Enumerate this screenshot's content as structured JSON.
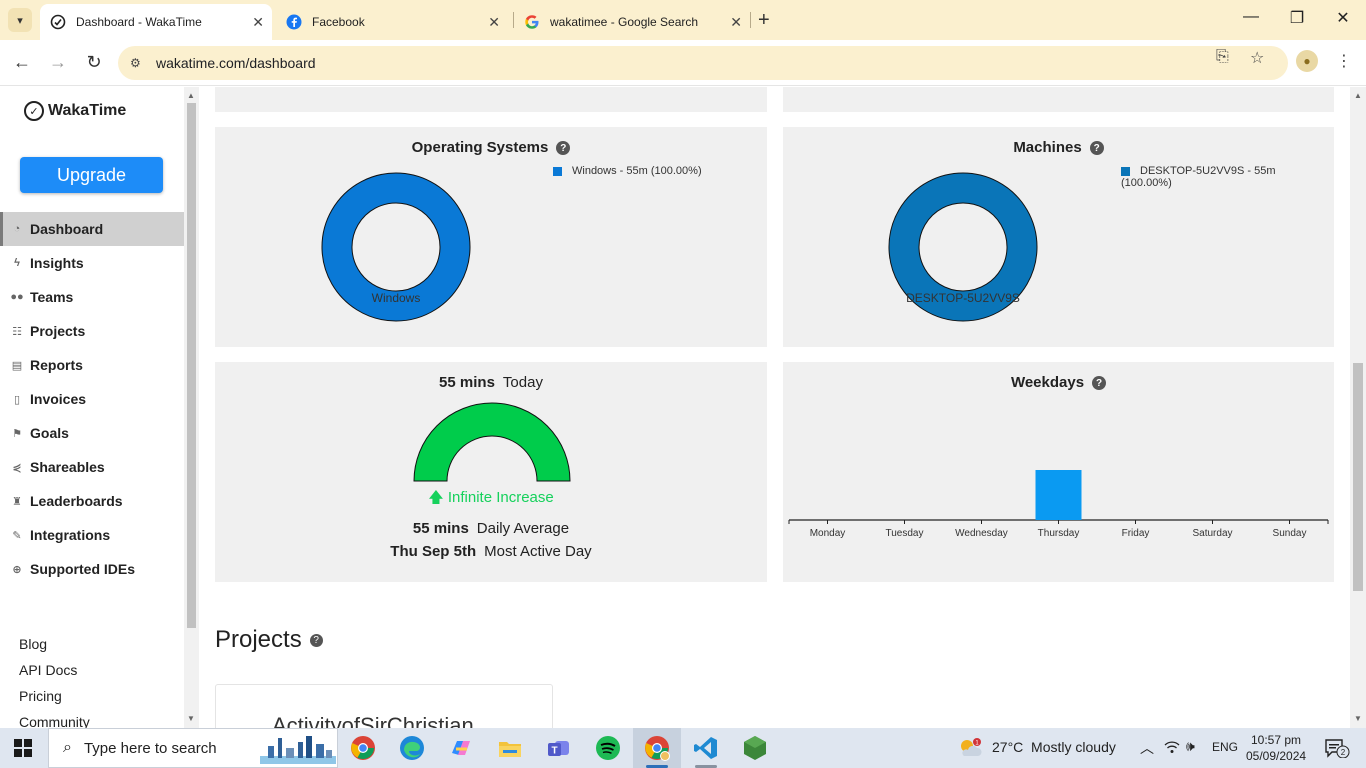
{
  "browser": {
    "tabs": [
      {
        "title": "Dashboard - WakaTime",
        "icon": "wakatime-icon"
      },
      {
        "title": "Facebook",
        "icon": "facebook-icon"
      },
      {
        "title": "wakatimee - Google Search",
        "icon": "google-icon"
      }
    ],
    "url": "wakatime.com/dashboard"
  },
  "sidebar": {
    "logo": "WakaTime",
    "upgrade": "Upgrade",
    "nav": [
      {
        "label": "Dashboard",
        "icon": "dashboard-icon",
        "active": true
      },
      {
        "label": "Insights",
        "icon": "bolt-icon"
      },
      {
        "label": "Teams",
        "icon": "users-icon"
      },
      {
        "label": "Projects",
        "icon": "grid-icon"
      },
      {
        "label": "Reports",
        "icon": "report-icon"
      },
      {
        "label": "Invoices",
        "icon": "invoice-icon"
      },
      {
        "label": "Goals",
        "icon": "flag-icon"
      },
      {
        "label": "Shareables",
        "icon": "share-icon"
      },
      {
        "label": "Leaderboards",
        "icon": "trophy-icon"
      },
      {
        "label": "Integrations",
        "icon": "wrench-icon"
      },
      {
        "label": "Supported IDEs",
        "icon": "plus-circle-icon"
      }
    ],
    "links": [
      "Blog",
      "API Docs",
      "Pricing",
      "Community"
    ]
  },
  "cards": {
    "os": {
      "title": "Operating Systems",
      "legend": "Windows - 55m (100.00%)",
      "slice_label": "Windows",
      "color": "#0a79d6"
    },
    "machines": {
      "title": "Machines",
      "legend_line1": "DESKTOP-5U2VV9S - 55m",
      "legend_line2": "(100.00%)",
      "slice_label": "DESKTOP-5U2VV9S",
      "color": "#0a75b8"
    },
    "today": {
      "value": "55 mins",
      "label": "Today",
      "increase": "Infinite Increase",
      "avg_value": "55 mins",
      "avg_label": "Daily Average",
      "active_value": "Thu Sep 5th",
      "active_label": "Most Active Day",
      "gauge_color": "#00cc4b"
    },
    "weekdays": {
      "title": "Weekdays"
    }
  },
  "chart_data": [
    {
      "type": "pie",
      "labels": [
        "Windows"
      ],
      "values": [
        100.0
      ],
      "title": "Operating Systems"
    },
    {
      "type": "pie",
      "labels": [
        "DESKTOP-5U2VV9S"
      ],
      "values": [
        100.0
      ],
      "title": "Machines"
    },
    {
      "type": "bar",
      "title": "Weekdays",
      "categories": [
        "Monday",
        "Tuesday",
        "Wednesday",
        "Thursday",
        "Friday",
        "Saturday",
        "Sunday"
      ],
      "values": [
        0,
        0,
        0,
        55,
        0,
        0,
        0
      ],
      "bar_color": "#0a9af2"
    }
  ],
  "projects": {
    "heading": "Projects",
    "first_project": "ActivityofSirChristian"
  },
  "taskbar": {
    "search_placeholder": "Type here to search",
    "weather": "27°C  Mostly cloudy",
    "weather_badge": "1",
    "language": "ENG",
    "time": "10:57 pm",
    "date": "05/09/2024",
    "notifications": "2"
  }
}
